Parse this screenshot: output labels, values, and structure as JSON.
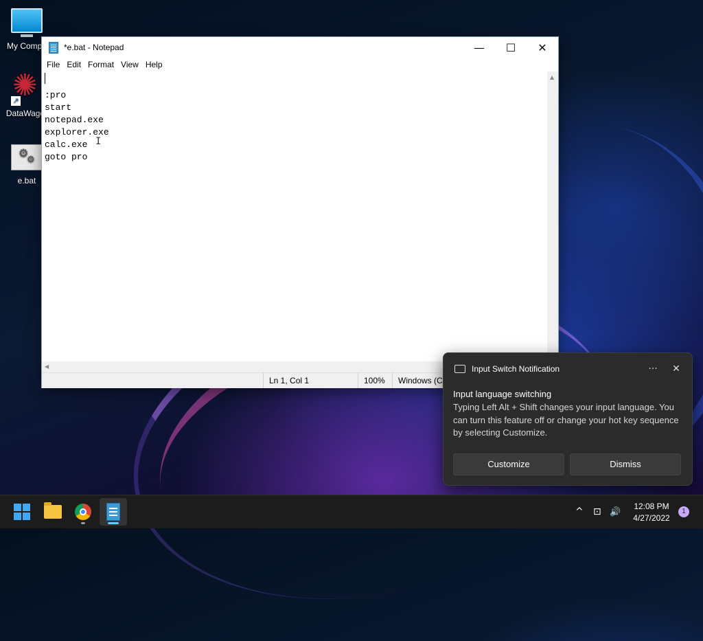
{
  "desktop": {
    "icons": [
      {
        "label": "My Compu"
      },
      {
        "label": "DataWagor"
      },
      {
        "label": "e.bat"
      }
    ]
  },
  "notepad": {
    "title": "*e.bat - Notepad",
    "menu": [
      "File",
      "Edit",
      "Format",
      "View",
      "Help"
    ],
    "lines": [
      "",
      ":pro",
      "start",
      "notepad.exe",
      "explorer.exe",
      "calc.exe",
      "goto pro"
    ],
    "status": {
      "position": "Ln 1, Col 1",
      "zoom": "100%",
      "encoding": "Windows (CI"
    },
    "controls": {
      "minimize": "—",
      "maximize": "☐",
      "close": "✕"
    }
  },
  "notification": {
    "app_name": "Input Switch Notification",
    "more": "···",
    "close": "✕",
    "title": "Input language switching",
    "body": "Typing Left Alt + Shift changes your input language. You can turn this feature off or change your hot key sequence by selecting Customize.",
    "buttons": {
      "customize": "Customize",
      "dismiss": "Dismiss"
    }
  },
  "taskbar": {
    "apps": [
      "start-icon",
      "file-explorer-icon",
      "chrome-icon",
      "notepad-icon"
    ],
    "tray": {
      "chevron": "^",
      "network": "⊡",
      "volume": "🔊"
    },
    "time": "12:08 PM",
    "date": "4/27/2022",
    "notification_count": "1"
  }
}
